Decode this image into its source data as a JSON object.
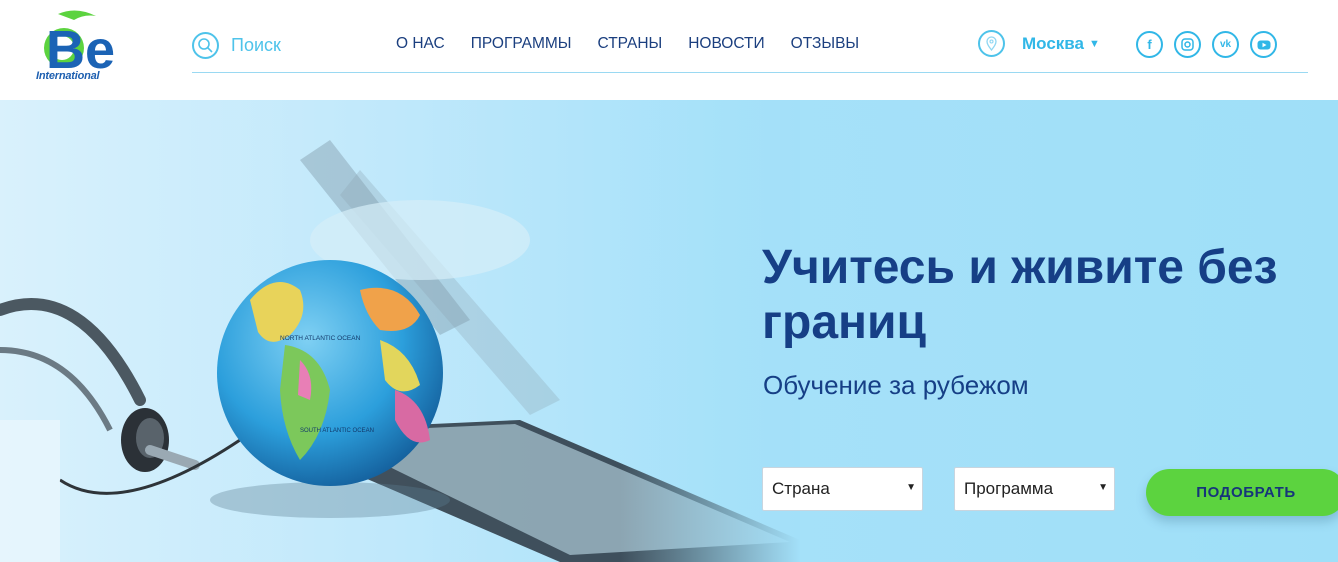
{
  "brand": {
    "logo_text": "Be",
    "logo_subtext": "International"
  },
  "header": {
    "search_label": "Поиск",
    "nav": [
      "О нас",
      "Программы",
      "Страны",
      "Новости",
      "Отзывы"
    ],
    "location": "Москва",
    "socials": [
      "facebook-icon",
      "instagram-icon",
      "vk-icon",
      "youtube-icon"
    ]
  },
  "hero": {
    "title": "Учитесь и живите без границ",
    "subtitle": "Обучение за рубежом",
    "country_select": "Страна",
    "program_select": "Программа",
    "submit_label": "ПОДОБРАТЬ",
    "globe_labels": [
      "NORTH ATLANTIC OCEAN",
      "SOUTH ATLANTIC OCEAN"
    ]
  },
  "colors": {
    "navy": "#163f86",
    "accent": "#31b7e7",
    "green": "#5cd33f"
  }
}
